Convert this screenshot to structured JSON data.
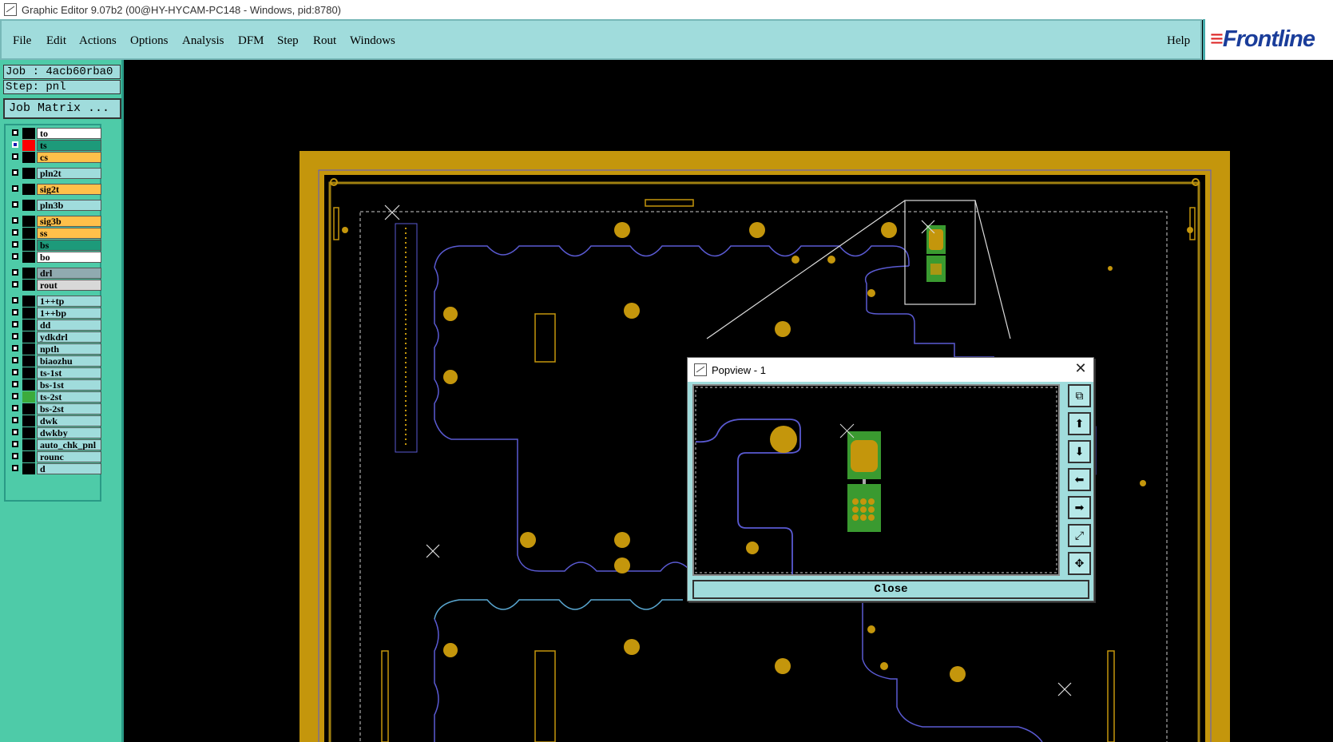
{
  "window": {
    "title": "Graphic Editor 9.07b2 (00@HY-HYCAM-PC148 - Windows, pid:8780)"
  },
  "menu": {
    "file": "File",
    "edit": "Edit",
    "actions": "Actions",
    "options": "Options",
    "analysis": "Analysis",
    "dfm": "DFM",
    "step": "Step",
    "rout": "Rout",
    "windows": "Windows",
    "help": "Help"
  },
  "logo": {
    "text": "Frontline"
  },
  "job": {
    "label": "Job : 4acb60rba0",
    "step": "Step: pnl",
    "matrix_button": "Job Matrix ..."
  },
  "layers": [
    {
      "name": "to",
      "bg": "#ffffff",
      "dot": "#000000"
    },
    {
      "name": "ts",
      "bg": "#1d9a7a",
      "dot": "#ff0000",
      "active": true
    },
    {
      "name": "cs",
      "bg": "#ffc04a",
      "dot": "#000000"
    },
    {
      "name": "pln2t",
      "bg": "#a0dcdc",
      "dot": "#000000"
    },
    {
      "name": "sig2t",
      "bg": "#ffc04a",
      "dot": "#000000"
    },
    {
      "name": "pln3b",
      "bg": "#a0dcdc",
      "dot": "#000000"
    },
    {
      "name": "sig3b",
      "bg": "#ffc04a",
      "dot": "#000000"
    },
    {
      "name": "ss",
      "bg": "#ffc04a",
      "dot": "#000000"
    },
    {
      "name": "bs",
      "bg": "#1d9a7a",
      "dot": "#000000"
    },
    {
      "name": "bo",
      "bg": "#ffffff",
      "dot": "#000000"
    },
    {
      "name": "drl",
      "bg": "#90aab0",
      "dot": "#000000"
    },
    {
      "name": "rout",
      "bg": "#d8d8d8",
      "dot": "#000000"
    },
    {
      "name": "1++tp",
      "bg": "#a0dcdc",
      "dot": "#000000"
    },
    {
      "name": "1++bp",
      "bg": "#a0dcdc",
      "dot": "#000000"
    },
    {
      "name": "dd",
      "bg": "#a0dcdc",
      "dot": "#000000"
    },
    {
      "name": "ydkdrl",
      "bg": "#a0dcdc",
      "dot": "#000000"
    },
    {
      "name": "npth",
      "bg": "#a0dcdc",
      "dot": "#000000"
    },
    {
      "name": "biaozhu",
      "bg": "#a0dcdc",
      "dot": "#000000"
    },
    {
      "name": "ts-1st",
      "bg": "#a0dcdc",
      "dot": "#000000"
    },
    {
      "name": "bs-1st",
      "bg": "#a0dcdc",
      "dot": "#000000"
    },
    {
      "name": "ts-2st",
      "bg": "#a0dcdc",
      "dot": "#3cab3c"
    },
    {
      "name": "bs-2st",
      "bg": "#a0dcdc",
      "dot": "#000000"
    },
    {
      "name": "dwk",
      "bg": "#a0dcdc",
      "dot": "#000000"
    },
    {
      "name": "dwkby",
      "bg": "#a0dcdc",
      "dot": "#000000"
    },
    {
      "name": "auto_chk_pnl",
      "bg": "#a0dcdc",
      "dot": "#000000"
    },
    {
      "name": "rounc",
      "bg": "#a0dcdc",
      "dot": "#000000"
    },
    {
      "name": "d",
      "bg": "#a0dcdc",
      "dot": "#000000"
    }
  ],
  "popview": {
    "title": "Popview - 1",
    "close_button": "Close",
    "tools": [
      "zoom-window-icon",
      "pan-up-icon",
      "pan-down-icon",
      "pan-left-icon",
      "pan-right-icon",
      "zoom-home-icon",
      "fit-icon"
    ]
  },
  "colors": {
    "copper": "#c4960c",
    "trace": "#5a5ad2",
    "pad_green": "#3a9a30",
    "menu_bg": "#a0dcdc",
    "panel_bg": "#4ecba8"
  }
}
